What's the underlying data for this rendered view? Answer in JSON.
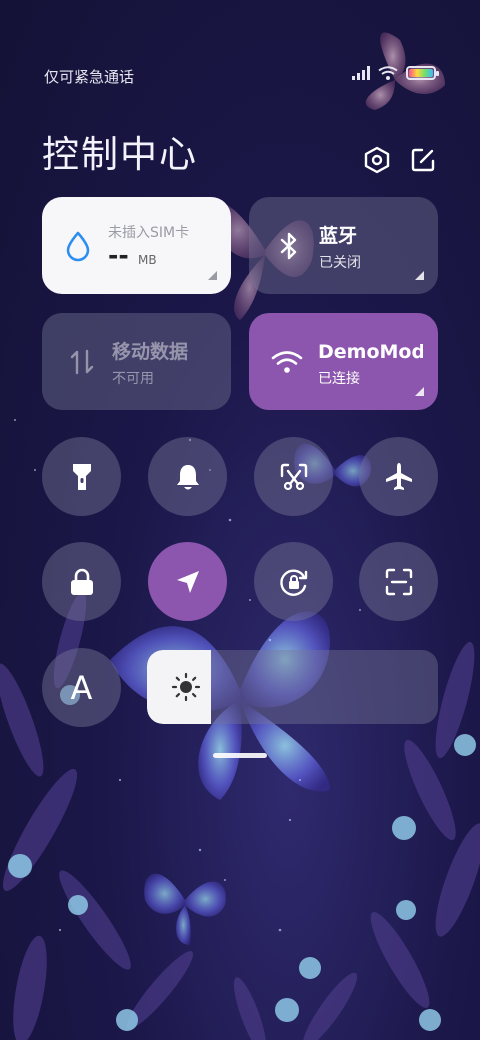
{
  "status_bar": {
    "carrier": "仅可紧急通话",
    "signal_icon": "signal-bars-icon",
    "wifi_icon": "wifi-icon",
    "battery_icon": "battery-icon"
  },
  "header": {
    "title": "控制中心",
    "settings_icon": "settings-hexagon-icon",
    "edit_icon": "edit-icon"
  },
  "tiles": {
    "data_usage": {
      "label": "未插入SIM卡",
      "value": "--",
      "unit": "MB",
      "icon": "water-drop-icon"
    },
    "bluetooth": {
      "title": "蓝牙",
      "status": "已关闭",
      "icon": "bluetooth-icon"
    },
    "mobile_data": {
      "title": "移动数据",
      "status": "不可用",
      "icon": "data-arrows-icon"
    },
    "wifi": {
      "title": "DemoMod",
      "status": "已连接",
      "icon": "wifi-icon"
    }
  },
  "toggles": [
    {
      "icon": "flashlight-icon",
      "active": false
    },
    {
      "icon": "bell-icon",
      "active": false
    },
    {
      "icon": "screenshot-icon",
      "active": false
    },
    {
      "icon": "airplane-icon",
      "active": false
    },
    {
      "icon": "lock-icon",
      "active": false
    },
    {
      "icon": "location-icon",
      "active": true
    },
    {
      "icon": "rotation-lock-icon",
      "active": false
    },
    {
      "icon": "scan-icon",
      "active": false
    }
  ],
  "brightness": {
    "font_button": "A",
    "icon": "sun-icon",
    "level_fraction": 0.22
  },
  "colors": {
    "accent": "#8d56ae",
    "tile_dim": "rgba(120,118,150,0.42)",
    "tile_light": "#f7f7fa",
    "drop_blue": "#2c8ef0"
  }
}
